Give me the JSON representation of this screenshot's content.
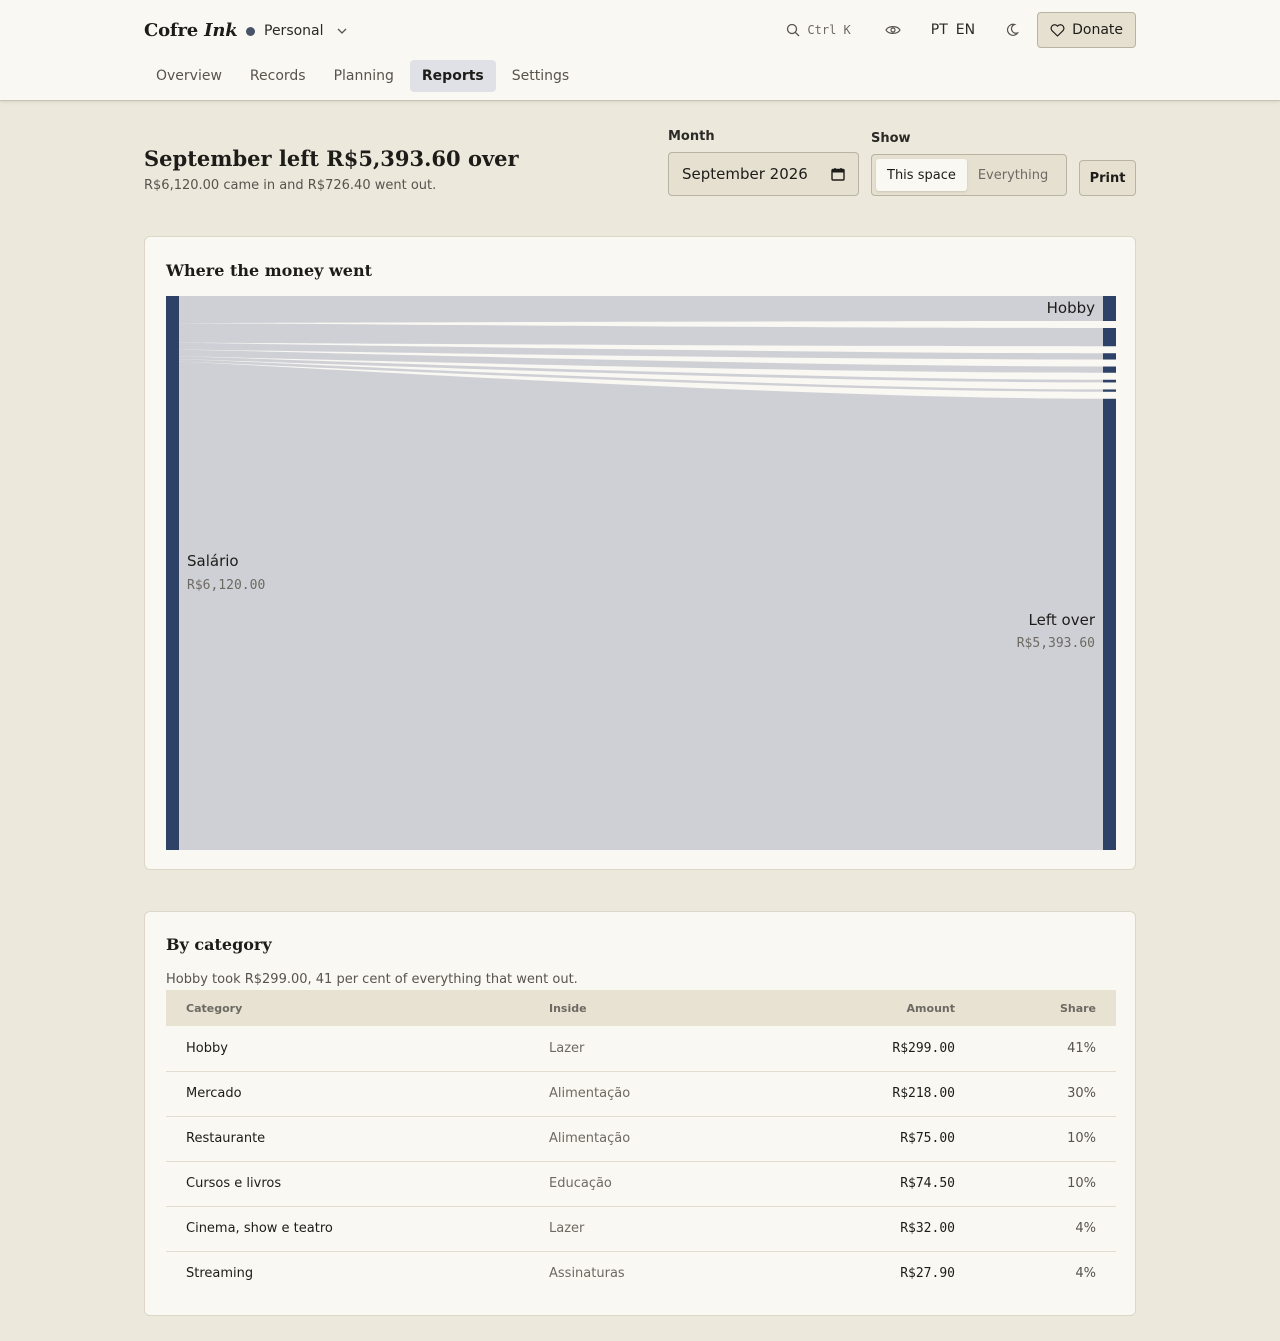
{
  "app": {
    "brand_regular": "Cofre",
    "brand_italic": "Ink",
    "space_name": "Personal",
    "search_shortcut": "Ctrl K",
    "lang_pt": "PT",
    "lang_en": "EN",
    "donate_label": "Donate",
    "tabs": [
      {
        "label": "Overview"
      },
      {
        "label": "Records"
      },
      {
        "label": "Planning"
      },
      {
        "label": "Reports",
        "active": true
      },
      {
        "label": "Settings"
      }
    ],
    "colors": {
      "accent": "#2e4166",
      "flow": "#cfd0d6",
      "background": "#ede8dc",
      "surface": "#faf8f2"
    }
  },
  "summary": {
    "title": "September left R$5,393.60 over",
    "subtitle": "R$6,120.00 came in and R$726.40 went out."
  },
  "controls": {
    "month_label": "Month",
    "month_value": "September 2026",
    "show_label": "Show",
    "show_options": [
      "This space",
      "Everything"
    ],
    "show_selected": "This space",
    "print_label": "Print"
  },
  "flow": {
    "title": "Where the money went",
    "source": {
      "label": "Salário",
      "amount_text": "R$6,120.00",
      "value": 6120.0
    },
    "targets": [
      {
        "label": "Hobby",
        "value": 299.0
      },
      {
        "label": "Mercado",
        "value": 218.0
      },
      {
        "label": "Restaurante",
        "value": 75.0
      },
      {
        "label": "Cursos e livros",
        "value": 74.5
      },
      {
        "label": "Cinema, show e teatro",
        "value": 32.0
      },
      {
        "label": "Streaming",
        "value": 27.9
      },
      {
        "label": "Left over",
        "value": 5393.6,
        "amount_text": "R$5,393.60"
      }
    ],
    "visible_labels": [
      "Hobby",
      "Left over"
    ]
  },
  "categories": {
    "title": "By category",
    "caption": "Hobby took R$299.00, 41 per cent of everything that went out.",
    "headers": {
      "category": "Category",
      "inside": "Inside",
      "amount": "Amount",
      "share": "Share"
    },
    "rows": [
      {
        "category": "Hobby",
        "inside": "Lazer",
        "amount": "R$299.00",
        "share": "41%"
      },
      {
        "category": "Mercado",
        "inside": "Alimentação",
        "amount": "R$218.00",
        "share": "30%"
      },
      {
        "category": "Restaurante",
        "inside": "Alimentação",
        "amount": "R$75.00",
        "share": "10%"
      },
      {
        "category": "Cursos e livros",
        "inside": "Educação",
        "amount": "R$74.50",
        "share": "10%"
      },
      {
        "category": "Cinema, show e teatro",
        "inside": "Lazer",
        "amount": "R$32.00",
        "share": "4%"
      },
      {
        "category": "Streaming",
        "inside": "Assinaturas",
        "amount": "R$27.90",
        "share": "4%"
      }
    ]
  }
}
